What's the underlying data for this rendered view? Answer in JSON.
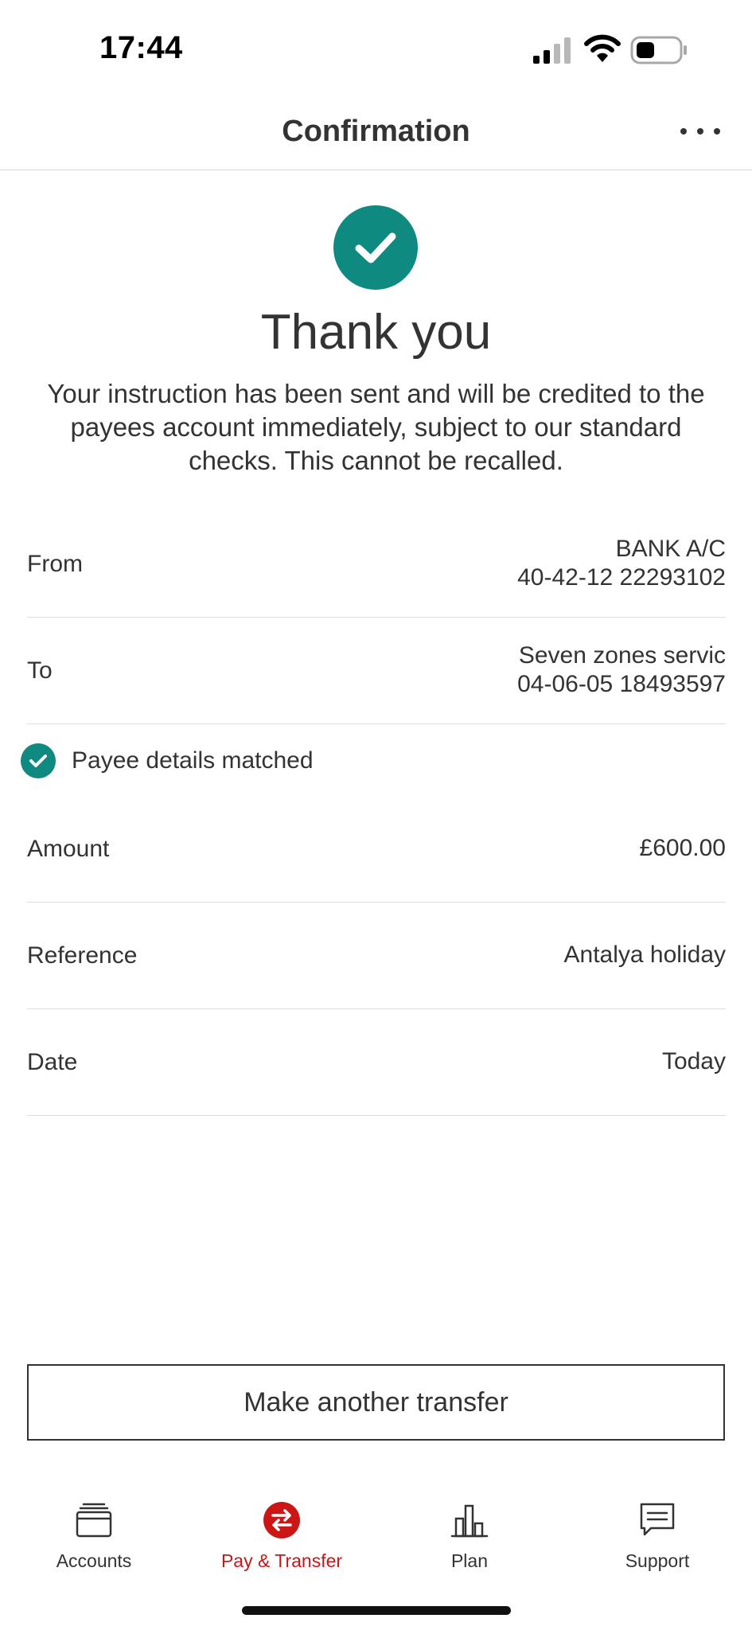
{
  "status_bar": {
    "time": "17:44"
  },
  "header": {
    "title": "Confirmation"
  },
  "success": {
    "heading": "Thank you",
    "message": "Your instruction has been sent and will be credited to the payees account immediately, subject to our standard checks.  This cannot be recalled."
  },
  "details": {
    "from": {
      "label": "From",
      "account_name": "BANK A/C",
      "account_number": "40-42-12 22293102"
    },
    "to": {
      "label": "To",
      "payee_name": "Seven zones servic",
      "account_number": "04-06-05 18493597"
    },
    "payee_match": "Payee details matched",
    "amount": {
      "label": "Amount",
      "value": "£600.00"
    },
    "reference": {
      "label": "Reference",
      "value": "Antalya holiday"
    },
    "date": {
      "label": "Date",
      "value": "Today"
    }
  },
  "actions": {
    "make_another_transfer": "Make another transfer"
  },
  "nav": {
    "items": [
      {
        "label": "Accounts",
        "icon": "wallet-icon"
      },
      {
        "label": "Pay & Transfer",
        "icon": "transfer-icon"
      },
      {
        "label": "Plan",
        "icon": "bar-chart-icon"
      },
      {
        "label": "Support",
        "icon": "chat-icon"
      }
    ],
    "active_index": 1
  },
  "colors": {
    "accent_teal": "#0e8a80",
    "active_red": "#cc1515",
    "text": "#333333"
  }
}
